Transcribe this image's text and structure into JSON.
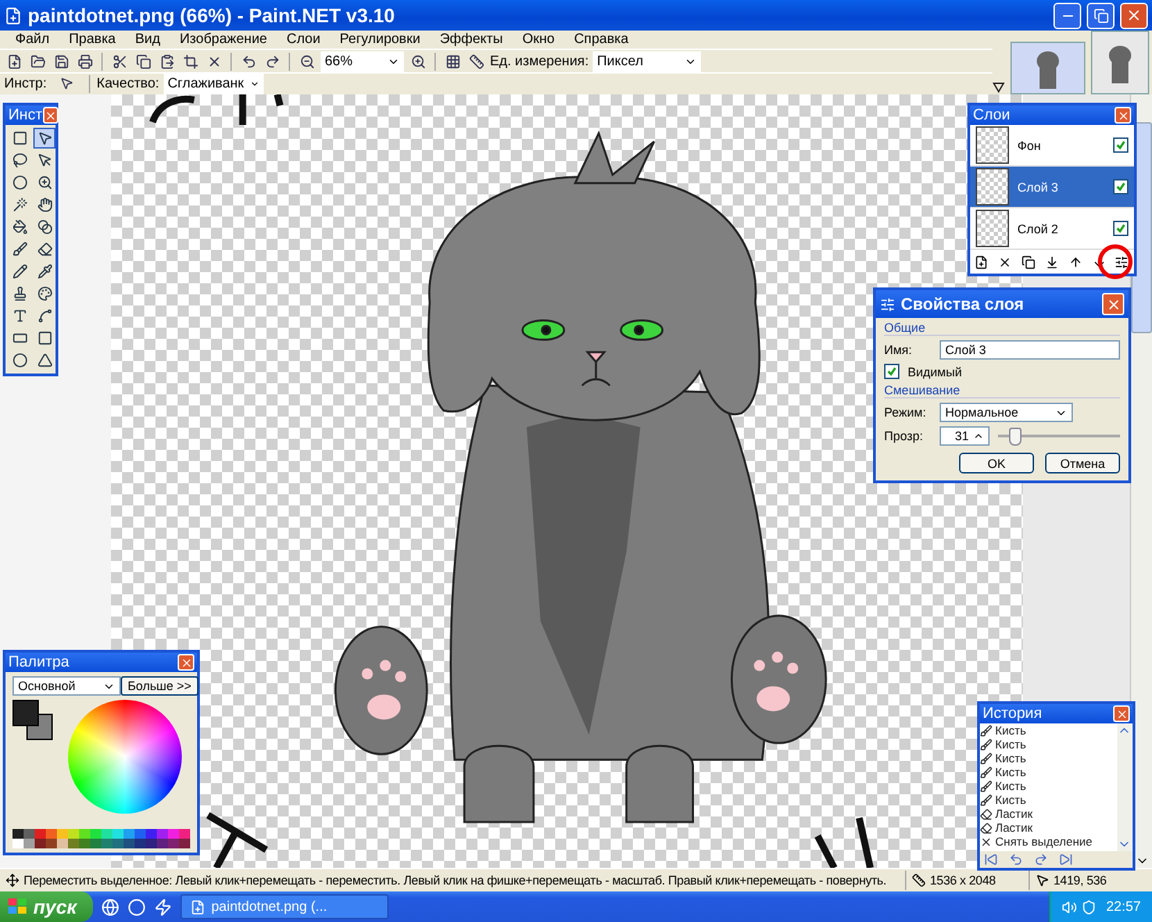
{
  "window": {
    "title": "paintdotnet.png (66%) - Paint.NET v3.10"
  },
  "menu": [
    "Файл",
    "Правка",
    "Вид",
    "Изображение",
    "Слои",
    "Регулировки",
    "Эффекты",
    "Окно",
    "Справка"
  ],
  "toolbar": {
    "zoom": "66%",
    "units_label": "Ед. измерения:",
    "units": "Пиксел"
  },
  "tool_options": {
    "tool_label": "Инстр:",
    "quality_label": "Качество:",
    "quality": "Сглаживанк"
  },
  "tools_panel": {
    "title": "Инст",
    "tools": [
      {
        "kind": "rect-select",
        "selected": false
      },
      {
        "kind": "move-selection",
        "selected": true
      },
      {
        "kind": "lasso",
        "selected": false
      },
      {
        "kind": "move-pixels",
        "selected": false
      },
      {
        "kind": "ellipse-select",
        "selected": false
      },
      {
        "kind": "zoom",
        "selected": false
      },
      {
        "kind": "magic-wand",
        "selected": false
      },
      {
        "kind": "pan",
        "selected": false
      },
      {
        "kind": "fill",
        "selected": false
      },
      {
        "kind": "gradient",
        "selected": false
      },
      {
        "kind": "brush",
        "selected": false
      },
      {
        "kind": "eraser",
        "selected": false
      },
      {
        "kind": "pencil",
        "selected": false
      },
      {
        "kind": "picker",
        "selected": false
      },
      {
        "kind": "stamp",
        "selected": false
      },
      {
        "kind": "recolor",
        "selected": false
      },
      {
        "kind": "text",
        "selected": false
      },
      {
        "kind": "line",
        "selected": false
      },
      {
        "kind": "rectangle",
        "selected": false
      },
      {
        "kind": "rounded-rectangle",
        "selected": false
      },
      {
        "kind": "ellipse",
        "selected": false
      },
      {
        "kind": "freeform",
        "selected": false
      }
    ]
  },
  "layers_panel": {
    "title": "Слои",
    "layers": [
      {
        "name": "Фон",
        "visible": true,
        "selected": false
      },
      {
        "name": "Слой 3",
        "visible": true,
        "selected": true
      },
      {
        "name": "Слой 2",
        "visible": true,
        "selected": false
      }
    ]
  },
  "layer_properties": {
    "title": "Свойства слоя",
    "general": "Общие",
    "name_label": "Имя:",
    "name": "Слой 3",
    "visible_label": "Видимый",
    "visible": true,
    "blending": "Смешивание",
    "mode_label": "Режим:",
    "mode": "Нормальное",
    "opacity_label": "Прозр:",
    "opacity": "31",
    "level": 0.12,
    "ok": "OK",
    "cancel": "Отмена"
  },
  "palette": {
    "title": "Палитра",
    "set": "Основной",
    "more": "Больше >>",
    "swatches": [
      {
        "color": "#202020"
      },
      {
        "color": "#606060"
      },
      {
        "color": "#e02020"
      },
      {
        "color": "#f06020"
      },
      {
        "color": "#f8c020"
      },
      {
        "color": "#c0e020"
      },
      {
        "color": "#60e020"
      },
      {
        "color": "#20e040"
      },
      {
        "color": "#20e0a0"
      },
      {
        "color": "#20e0e0"
      },
      {
        "color": "#20a0f0"
      },
      {
        "color": "#2060f0"
      },
      {
        "color": "#4020f0"
      },
      {
        "color": "#a020f0"
      },
      {
        "color": "#f020e0"
      },
      {
        "color": "#f02080"
      },
      {
        "color": "#ffffff"
      },
      {
        "color": "#a0a0a0"
      },
      {
        "color": "#802020"
      },
      {
        "color": "#904020"
      },
      {
        "color": "#e0c0a0"
      },
      {
        "color": "#708020"
      },
      {
        "color": "#408020"
      },
      {
        "color": "#208040"
      },
      {
        "color": "#208070"
      },
      {
        "color": "#207080"
      },
      {
        "color": "#205080"
      },
      {
        "color": "#203080"
      },
      {
        "color": "#302080"
      },
      {
        "color": "#602080"
      },
      {
        "color": "#802070"
      },
      {
        "color": "#802040"
      }
    ]
  },
  "history": {
    "title": "История",
    "items": [
      {
        "kind": "brush",
        "label": "Кисть"
      },
      {
        "kind": "brush",
        "label": "Кисть"
      },
      {
        "kind": "brush",
        "label": "Кисть"
      },
      {
        "kind": "brush",
        "label": "Кисть"
      },
      {
        "kind": "brush",
        "label": "Кисть"
      },
      {
        "kind": "brush",
        "label": "Кисть"
      },
      {
        "kind": "eraser",
        "label": "Ластик"
      },
      {
        "kind": "eraser",
        "label": "Ластик"
      },
      {
        "kind": "deselect",
        "label": "Снять выделение"
      }
    ]
  },
  "status_bar": {
    "hint": "Переместить выделенное: Левый клик+перемещать - переместить. Левый клик на фишке+перемещать - масштаб. Правый клик+перемещать - повернуть.",
    "image_size": "1536 x 2048",
    "cursor": "1419, 536"
  },
  "taskbar": {
    "start": "пуск",
    "tasks": [
      "paintdotnet.png (..."
    ],
    "clock": "22:57"
  }
}
